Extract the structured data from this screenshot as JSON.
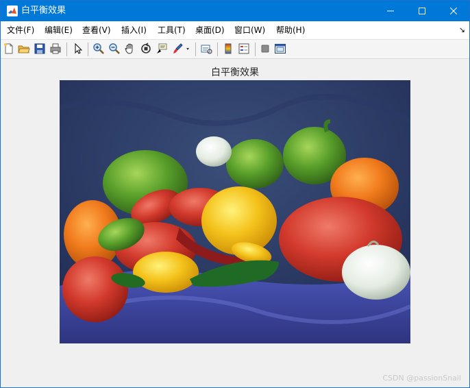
{
  "window": {
    "title": "白平衡效果",
    "controls": {
      "minimize": "—",
      "maximize": "☐",
      "close": "✕"
    }
  },
  "menubar": {
    "items": [
      "文件(F)",
      "编辑(E)",
      "查看(V)",
      "插入(I)",
      "工具(T)",
      "桌面(D)",
      "窗口(W)",
      "帮助(H)"
    ],
    "corner_glyph": "↘"
  },
  "toolbar": {
    "buttons": [
      "new-figure-icon",
      "open-folder-icon",
      "save-icon",
      "print-icon",
      "pointer-icon",
      "zoom-in-icon",
      "zoom-out-icon",
      "pan-hand-icon",
      "rotate-3d-icon",
      "data-cursor-icon",
      "brush-icon",
      "link-plot-icon",
      "colorbar-icon",
      "legend-icon",
      "hide-plot-tools-icon",
      "show-plot-tools-icon"
    ]
  },
  "figure": {
    "title": "白平衡效果",
    "image_alt": "peppers photo"
  },
  "watermark": "CSDN @passionSnail",
  "colors": {
    "titlebar": "#0078d7",
    "background": "#f0f0f0"
  }
}
